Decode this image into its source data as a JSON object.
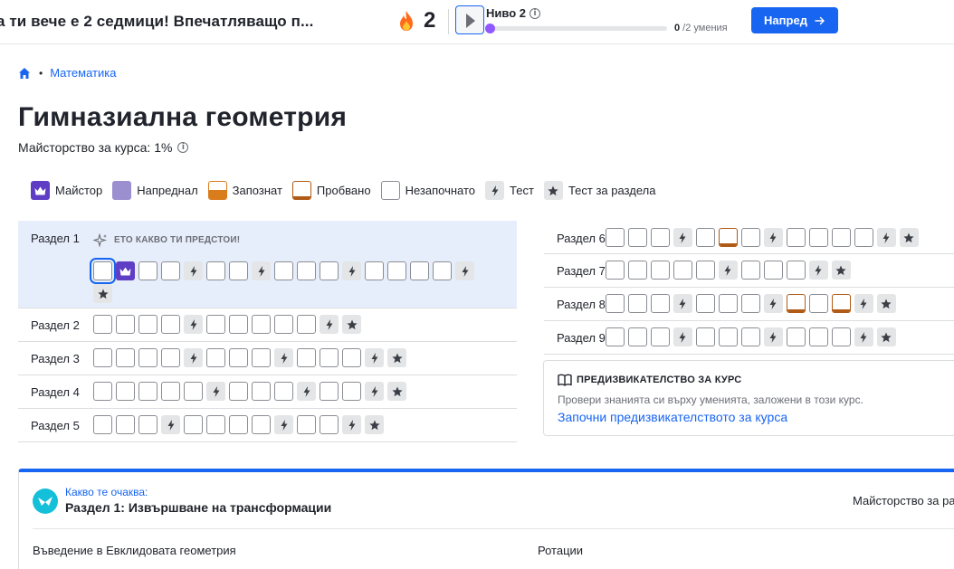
{
  "topbar": {
    "streak_message": "а ти вече е 2 седмици! Впечатляващо п...",
    "streak_count": "2",
    "level_label": "Ниво 2",
    "skills_done": "0",
    "skills_total": " /2 умения",
    "level_progress": 0,
    "next_button": "Напред"
  },
  "breadcrumb": {
    "subject": "Математика"
  },
  "course": {
    "title": "Гимназиална геометрия",
    "mastery": "Майсторство за курса: 1%"
  },
  "legend": {
    "mastered": "Майстор",
    "proficient": "Напреднал",
    "familiar": "Запознат",
    "attempted": "Пробвано",
    "not_started": "Незапочнато",
    "quiz": "Тест",
    "unit_test": "Тест за раздела"
  },
  "preview_label": "ЕТО КАКВО ТИ ПРЕДСТОИ!",
  "units_left": [
    {
      "name": "Раздел 1",
      "squares": [
        "new",
        "master",
        "new",
        "new",
        "test",
        "new",
        "new",
        "test",
        "new",
        "new",
        "new",
        "test",
        "new",
        "new",
        "new",
        "new",
        "test",
        "utest"
      ]
    },
    {
      "name": "Раздел 2",
      "squares": [
        "new",
        "new",
        "new",
        "new",
        "test",
        "new",
        "new",
        "new",
        "new",
        "new",
        "test",
        "utest"
      ]
    },
    {
      "name": "Раздел 3",
      "squares": [
        "new",
        "new",
        "new",
        "new",
        "test",
        "new",
        "new",
        "new",
        "test",
        "new",
        "new",
        "new",
        "test",
        "utest"
      ]
    },
    {
      "name": "Раздел 4",
      "squares": [
        "new",
        "new",
        "new",
        "new",
        "new",
        "test",
        "new",
        "new",
        "new",
        "test",
        "new",
        "new",
        "test",
        "utest"
      ]
    },
    {
      "name": "Раздел 5",
      "squares": [
        "new",
        "new",
        "new",
        "test",
        "new",
        "new",
        "new",
        "new",
        "test",
        "new",
        "new",
        "test",
        "utest"
      ]
    }
  ],
  "units_right": [
    {
      "name": "Раздел 6",
      "squares": [
        "new",
        "new",
        "new",
        "test",
        "new",
        "att",
        "new",
        "test",
        "new",
        "new",
        "new",
        "new",
        "test",
        "utest"
      ]
    },
    {
      "name": "Раздел 7",
      "squares": [
        "new",
        "new",
        "new",
        "new",
        "new",
        "test",
        "new",
        "new",
        "new",
        "test",
        "utest"
      ]
    },
    {
      "name": "Раздел 8",
      "squares": [
        "new",
        "new",
        "new",
        "test",
        "new",
        "new",
        "new",
        "test",
        "att",
        "new",
        "att",
        "test",
        "utest"
      ]
    },
    {
      "name": "Раздел 9",
      "squares": [
        "new",
        "new",
        "new",
        "test",
        "new",
        "new",
        "new",
        "test",
        "new",
        "new",
        "new",
        "test",
        "utest"
      ]
    }
  ],
  "challenge": {
    "title": "ПРЕДИЗВИКАТЕЛСТВО ЗА КУРС",
    "description": "Провери знанията си върху уменията, заложени в този курс.",
    "link": "Започни предизвикателството за курса"
  },
  "up_next": {
    "label": "Какво те очаква:",
    "title": "Раздел 1: Извършване на трансформации",
    "mastery": "Майсторство за раз",
    "lessons": [
      "Въведение в Евклидовата геометрия",
      "Ротации"
    ]
  },
  "colors": {
    "accent": "#1865f2",
    "mastered": "#5f3dc4",
    "proficient": "#9b8fd0",
    "familiar": "#d97c1b",
    "attempted": "#b05b15"
  }
}
